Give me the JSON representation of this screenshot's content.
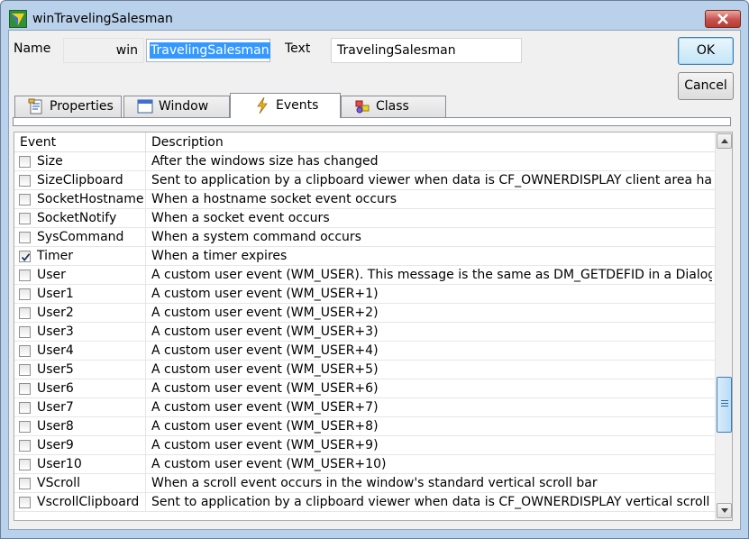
{
  "window": {
    "title": "winTravelingSalesman"
  },
  "header": {
    "name_label": "Name",
    "name_prefix": "win",
    "name_value": "TravelingSalesman",
    "text_label": "Text",
    "text_value": "TravelingSalesman"
  },
  "buttons": {
    "ok": "OK",
    "cancel": "Cancel"
  },
  "tabs": [
    {
      "label": "Properties",
      "icon": "properties-icon",
      "active": false
    },
    {
      "label": "Window",
      "icon": "window-icon",
      "active": false
    },
    {
      "label": "Events",
      "icon": "lightning-icon",
      "active": true
    },
    {
      "label": "Class",
      "icon": "class-icon",
      "active": false
    }
  ],
  "grid": {
    "columns": [
      "Event",
      "Description"
    ],
    "rows": [
      {
        "event": "Size",
        "description": "After the windows size has changed",
        "checked": false
      },
      {
        "event": "SizeClipboard",
        "description": "Sent to application by a clipboard viewer when data is CF_OWNERDISPLAY client area has ...",
        "checked": false
      },
      {
        "event": "SocketHostname",
        "description": "When a hostname socket event occurs",
        "checked": false
      },
      {
        "event": "SocketNotify",
        "description": "When a socket event occurs",
        "checked": false
      },
      {
        "event": "SysCommand",
        "description": "When a system command occurs",
        "checked": false
      },
      {
        "event": "Timer",
        "description": "When a timer expires",
        "checked": true
      },
      {
        "event": "User",
        "description": "A custom user event (WM_USER).  This message is the same as DM_GETDEFID in a Dialog",
        "checked": false
      },
      {
        "event": "User1",
        "description": "A custom user event (WM_USER+1)",
        "checked": false
      },
      {
        "event": "User2",
        "description": "A custom user event (WM_USER+2)",
        "checked": false
      },
      {
        "event": "User3",
        "description": "A custom user event (WM_USER+3)",
        "checked": false
      },
      {
        "event": "User4",
        "description": "A custom user event (WM_USER+4)",
        "checked": false
      },
      {
        "event": "User5",
        "description": "A custom user event (WM_USER+5)",
        "checked": false
      },
      {
        "event": "User6",
        "description": "A custom user event (WM_USER+6)",
        "checked": false
      },
      {
        "event": "User7",
        "description": "A custom user event (WM_USER+7)",
        "checked": false
      },
      {
        "event": "User8",
        "description": "A custom user event (WM_USER+8)",
        "checked": false
      },
      {
        "event": "User9",
        "description": "A custom user event (WM_USER+9)",
        "checked": false
      },
      {
        "event": "User10",
        "description": "A custom user event (WM_USER+10)",
        "checked": false
      },
      {
        "event": "VScroll",
        "description": "When a scroll event occurs in the window's standard vertical scroll bar",
        "checked": false
      },
      {
        "event": "VscrollClipboard",
        "description": "Sent to application by a clipboard viewer when data is CF_OWNERDISPLAY vertical scroll bar",
        "checked": false
      }
    ]
  },
  "colors": {
    "selection": "#3399ff",
    "frame": "#b9d1ea",
    "close": "#c75050"
  }
}
